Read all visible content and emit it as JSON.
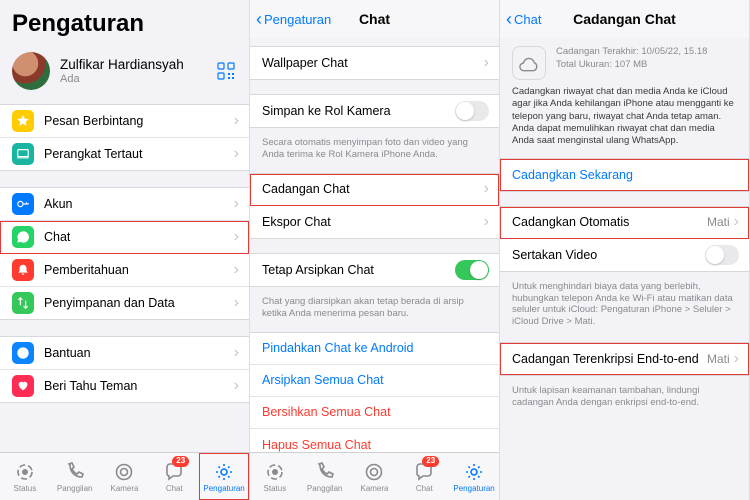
{
  "colors": {
    "accent": "#007aff",
    "destructive": "#ff3b30",
    "switch_on": "#34c759",
    "highlight": "#e53935"
  },
  "screen1": {
    "title": "Pengaturan",
    "profile": {
      "name": "Zulfikar Hardiansyah",
      "status": "Ada"
    },
    "group1": [
      {
        "label": "Pesan Berbintang",
        "icon": "star",
        "color": "c-yellow"
      },
      {
        "label": "Perangkat Tertaut",
        "icon": "laptop",
        "color": "c-teal"
      }
    ],
    "group2": [
      {
        "label": "Akun",
        "icon": "key",
        "color": "c-blue"
      },
      {
        "label": "Chat",
        "icon": "whatsapp",
        "color": "c-green",
        "highlight": true
      },
      {
        "label": "Pemberitahuan",
        "icon": "bell",
        "color": "c-red"
      },
      {
        "label": "Penyimpanan dan Data",
        "icon": "arrows",
        "color": "c-green2"
      }
    ],
    "group3": [
      {
        "label": "Bantuan",
        "icon": "info",
        "color": "c-blue2"
      },
      {
        "label": "Beri Tahu Teman",
        "icon": "heart",
        "color": "c-pink"
      }
    ]
  },
  "screen2": {
    "back": "Pengaturan",
    "title": "Chat",
    "rows": {
      "wallpaper": "Wallpaper Chat",
      "save_roll": "Simpan ke Rol Kamera",
      "save_roll_caption": "Secara otomatis menyimpan foto dan video yang Anda terima ke Rol Kamera iPhone Anda.",
      "backup": "Cadangan Chat",
      "export": "Ekspor Chat",
      "keep_archived": "Tetap Arsipkan Chat",
      "keep_archived_caption": "Chat yang diarsipkan akan tetap berada di arsip ketika Anda menerima pesan baru.",
      "move_android": "Pindahkan Chat ke Android",
      "archive_all": "Arsipkan Semua Chat",
      "clear_all": "Bersihkan Semua Chat",
      "delete_all": "Hapus Semua Chat"
    }
  },
  "screen3": {
    "back": "Chat",
    "title": "Cadangan Chat",
    "last_backup_label": "Cadangan Terakhir:",
    "last_backup_value": "10/05/22, 15.18",
    "total_size_label": "Total Ukuran:",
    "total_size_value": "107 MB",
    "description": "Cadangkan riwayat chat dan media Anda ke iCloud agar jika Anda kehilangan iPhone atau mengganti ke telepon yang baru, riwayat chat Anda tetap aman. Anda dapat memulihkan riwayat chat dan media Anda saat menginstal ulang WhatsApp.",
    "backup_now": "Cadangkan Sekarang",
    "auto_backup": "Cadangkan Otomatis",
    "auto_backup_value": "Mati",
    "include_video": "Sertakan Video",
    "wifi_caption": "Untuk menghindari biaya data yang berlebih, hubungkan telepon Anda ke Wi-Fi atau matikan data seluler untuk iCloud: Pengaturan iPhone > Seluler > iCloud Drive > Mati.",
    "e2e": "Cadangan Terenkripsi End-to-end",
    "e2e_value": "Mati",
    "e2e_caption": "Untuk lapisan keamanan tambahan, lindungi cadangan Anda dengan enkripsi end-to-end."
  },
  "tabs": {
    "status": "Status",
    "calls": "Panggilan",
    "camera": "Kamera",
    "chat": "Chat",
    "chat_badge": "23",
    "settings": "Pengaturan"
  }
}
